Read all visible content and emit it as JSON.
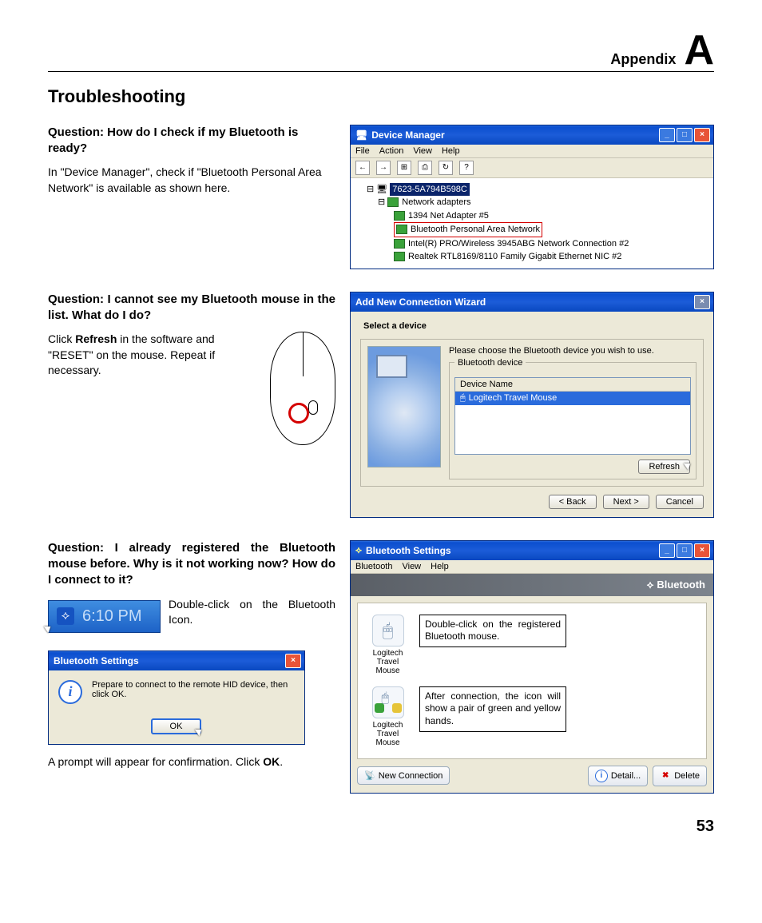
{
  "header": {
    "appendix_label": "Appendix",
    "letter": "A"
  },
  "section_title": "Troubleshooting",
  "q1": {
    "question": "Question: How do I check if my Bluetooth is ready?",
    "answer": "In \"Device Manager\", check if \"Bluetooth Personal Area Network\" is available as shown here."
  },
  "device_manager": {
    "title": "Device Manager",
    "menus": [
      "File",
      "Action",
      "View",
      "Help"
    ],
    "root": "7623-5A794B598C",
    "category": "Network adapters",
    "items": [
      "1394 Net Adapter #5",
      "Bluetooth Personal Area Network",
      "Intel(R) PRO/Wireless 3945ABG Network Connection #2",
      "Realtek RTL8169/8110 Family Gigabit Ethernet NIC #2"
    ]
  },
  "q2": {
    "question": "Question: I cannot see my Bluetooth mouse in the list. What do I do?",
    "answer_prefix": "Click ",
    "answer_bold": "Refresh",
    "answer_suffix": " in the software and \"RESET\" on the mouse. Repeat if necessary."
  },
  "wizard": {
    "title": "Add New Connection Wizard",
    "subtitle": "Select a device",
    "instruction": "Please choose the Bluetooth device you wish to use.",
    "fieldset": "Bluetooth device",
    "col_header": "Device Name",
    "device": "Logitech Travel Mouse",
    "refresh": "Refresh",
    "back": "< Back",
    "next": "Next >",
    "cancel": "Cancel"
  },
  "q3": {
    "question": "Question: I already registered the Bluetooth mouse before. Why is it not working now? How do I connect to it?",
    "tray_time": "6:10 PM",
    "instruction": "Double-click on the Bluetooth Icon.",
    "dlg_title": "Bluetooth Settings",
    "dlg_msg": "Prepare to connect to the remote HID device, then click OK.",
    "ok": "OK",
    "confirm_prefix": "A prompt will appear for confirmation. Click ",
    "confirm_bold": "OK",
    "confirm_suffix": "."
  },
  "bt_settings": {
    "title": "Bluetooth Settings",
    "menus": [
      "Bluetooth",
      "View",
      "Help"
    ],
    "brand": "Bluetooth",
    "dev1_label": "Logitech Travel Mouse",
    "dev2_label": "Logitech Travel Mouse",
    "callout1": "Double-click on the registered Bluetooth mouse.",
    "callout2": "After connection, the icon will show a pair of green and yellow hands.",
    "new_conn": "New Connection",
    "detail": "Detail...",
    "delete": "Delete"
  },
  "page_number": "53"
}
